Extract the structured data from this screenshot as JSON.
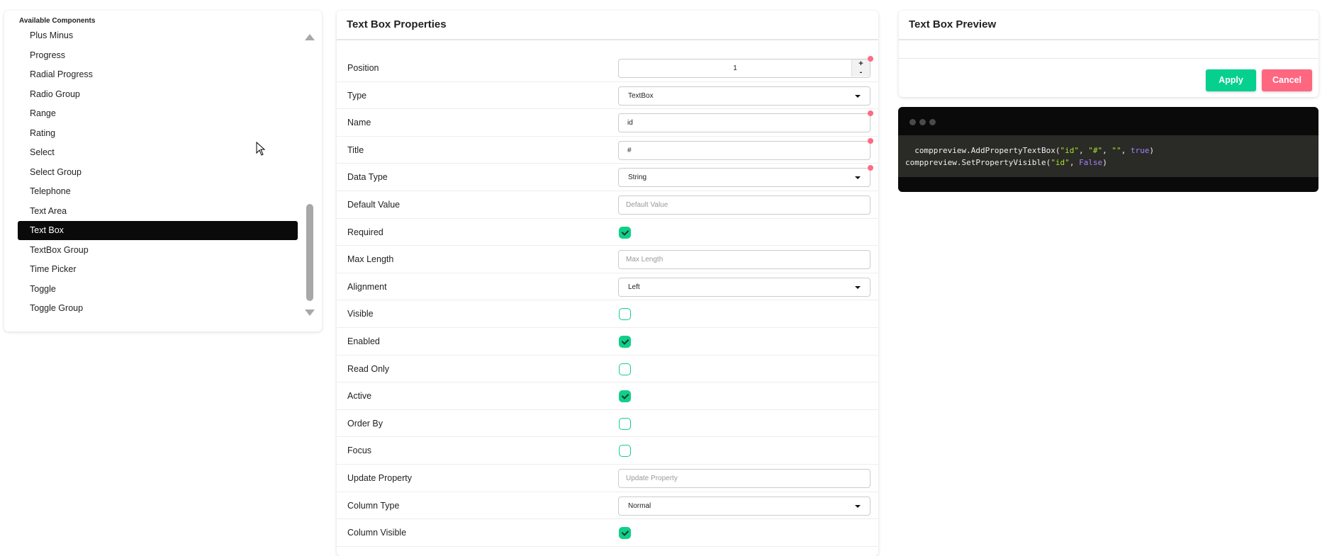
{
  "components": {
    "legend": "Available Components",
    "items": [
      "Plus Minus",
      "Progress",
      "Radial Progress",
      "Radio Group",
      "Range",
      "Rating",
      "Select",
      "Select Group",
      "Telephone",
      "Text Area",
      "Text Box",
      "TextBox Group",
      "Time Picker",
      "Toggle",
      "Toggle Group"
    ],
    "selected": "Text Box"
  },
  "properties": {
    "title": "Text Box Properties",
    "rows": [
      {
        "label": "Position",
        "kind": "number",
        "value": "1",
        "required": true,
        "plus": "+",
        "minus": "-"
      },
      {
        "label": "Type",
        "kind": "select",
        "value": "TextBox"
      },
      {
        "label": "Name",
        "kind": "text",
        "value": "id",
        "required": true
      },
      {
        "label": "Title",
        "kind": "text",
        "value": "#",
        "required": true
      },
      {
        "label": "Data Type",
        "kind": "select",
        "value": "String",
        "required": true
      },
      {
        "label": "Default Value",
        "kind": "placeholder",
        "value": "Default Value"
      },
      {
        "label": "Required",
        "kind": "check",
        "checked": true
      },
      {
        "label": "Max Length",
        "kind": "placeholder",
        "value": "Max Length"
      },
      {
        "label": "Alignment",
        "kind": "select",
        "value": "Left"
      },
      {
        "label": "Visible",
        "kind": "check",
        "checked": false
      },
      {
        "label": "Enabled",
        "kind": "check",
        "checked": true
      },
      {
        "label": "Read Only",
        "kind": "check",
        "checked": false
      },
      {
        "label": "Active",
        "kind": "check",
        "checked": true
      },
      {
        "label": "Order By",
        "kind": "check",
        "checked": false
      },
      {
        "label": "Focus",
        "kind": "check",
        "checked": false
      },
      {
        "label": "Update Property",
        "kind": "placeholder",
        "value": "Update Property"
      },
      {
        "label": "Column Type",
        "kind": "select",
        "value": "Normal"
      },
      {
        "label": "Column Visible",
        "kind": "check",
        "checked": true
      }
    ]
  },
  "preview": {
    "title": "Text Box Preview",
    "apply": "Apply",
    "cancel": "Cancel"
  },
  "code": {
    "line1": [
      {
        "t": "  comppreview.AddPropertyTextBox(",
        "c": ""
      },
      {
        "t": "\"id\"",
        "c": "s"
      },
      {
        "t": ", ",
        "c": ""
      },
      {
        "t": "\"#\"",
        "c": "s"
      },
      {
        "t": ", ",
        "c": ""
      },
      {
        "t": "\"\"",
        "c": "s"
      },
      {
        "t": ", ",
        "c": ""
      },
      {
        "t": "true",
        "c": "k"
      },
      {
        "t": ")",
        "c": ""
      }
    ],
    "line2": [
      {
        "t": "comppreview.SetPropertyVisible(",
        "c": ""
      },
      {
        "t": "\"id\"",
        "c": "s"
      },
      {
        "t": ", ",
        "c": ""
      },
      {
        "t": "False",
        "c": "k"
      },
      {
        "t": ")",
        "c": ""
      }
    ]
  },
  "colors": {
    "accent": "#10cf8a",
    "danger": "#ff6680",
    "required_dot": "#ff6b84"
  }
}
